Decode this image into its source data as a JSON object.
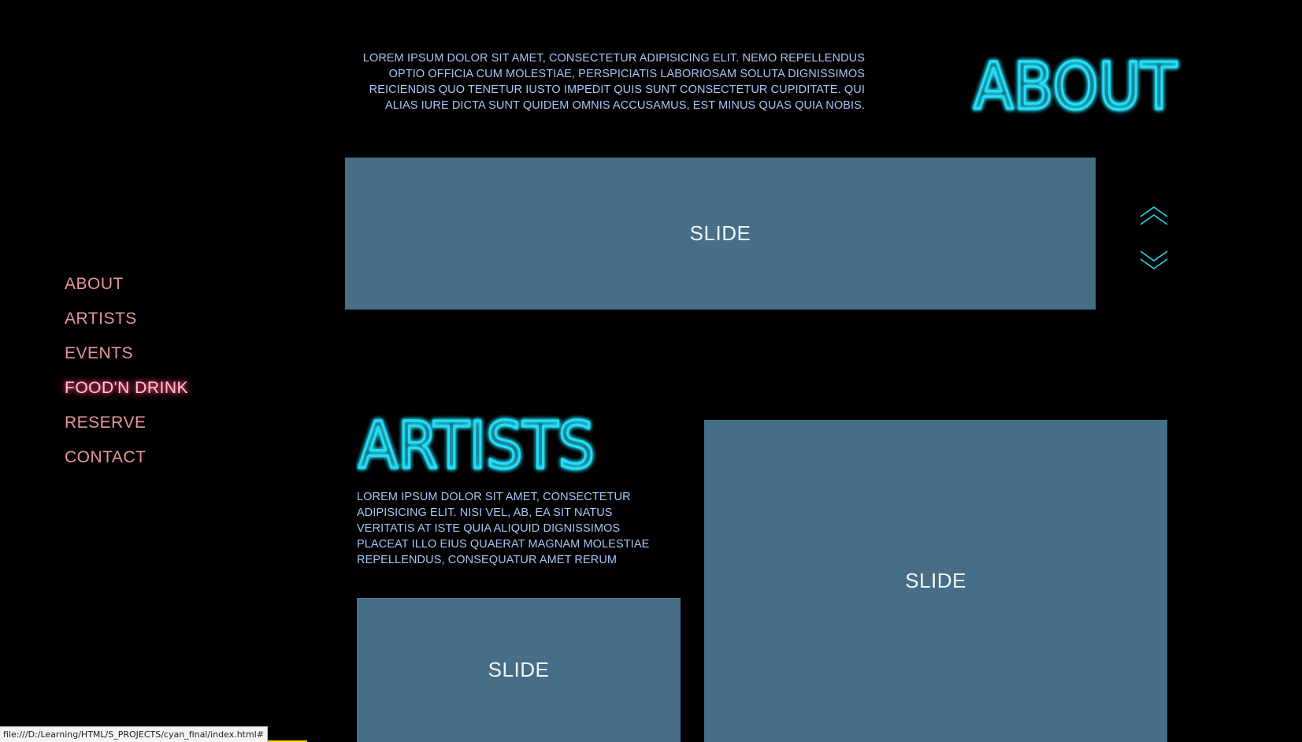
{
  "nav": {
    "items": [
      {
        "label": "ABOUT"
      },
      {
        "label": "ARTISTS"
      },
      {
        "label": "EVENTS"
      },
      {
        "label": "FOOD'N DRINK",
        "active": true
      },
      {
        "label": "RESERVE"
      },
      {
        "label": "CONTACT"
      }
    ]
  },
  "about": {
    "title": "ABOUT",
    "text": "LOREM IPSUM DOLOR SIT AMET, CONSECTETUR ADIPISICING ELIT. NEMO REPELLENDUS OPTIO OFFICIA CUM MOLESTIAE, PERSPICIATIS LABORIOSAM SOLUTA DIGNISSIMOS REICIENDIS QUO TENETUR IUSTO IMPEDIT QUIS SUNT CONSECTETUR CUPIDITATE. QUI ALIAS IURE DICTA SUNT QUIDEM OMNIS ACCUSAMUS, EST MINUS QUAS QUIA NOBIS.",
    "slide_label": "SLIDE"
  },
  "artists": {
    "title": "ARTISTS",
    "text": "LOREM IPSUM DOLOR SIT AMET, CONSECTETUR ADIPISICING ELIT. NISI VEL, AB, EA SIT NATUS VERITATIS AT ISTE QUIA ALIQUID DIGNISSIMOS PLACEAT ILLO EIUS QUAERAT MAGNAM MOLESTIAE REPELLENDUS, CONSEQUATUR AMET RERUM",
    "slide_left_label": "SLIDE",
    "slide_right_label": "SLIDE"
  },
  "slider_controls": {
    "up_icon": "chevron-double-up-icon",
    "down_icon": "chevron-double-down-icon"
  },
  "status_bar": {
    "url": "file:///D:/Learning/HTML/S_PROJECTS/cyan_final/index.html#"
  },
  "colors": {
    "background": "#000000",
    "nav_text": "#e8959c",
    "nav_active_glow": "#ff4d7a",
    "neon_cyan": "#22d8f2",
    "body_text": "#a9c6f2",
    "slide_bg": "#466e86",
    "slide_text": "#f1f6fa"
  }
}
